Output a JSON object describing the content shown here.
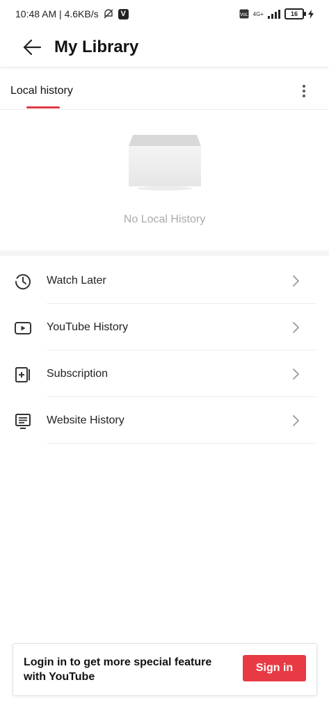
{
  "status_bar": {
    "time_speed": "10:48 AM | 4.6KB/s",
    "network": "4G+",
    "battery": "16"
  },
  "header": {
    "title": "My Library"
  },
  "tabs": {
    "active_label": "Local history"
  },
  "empty_state": {
    "message": "No Local History"
  },
  "menu": {
    "items": [
      {
        "label": "Watch Later",
        "icon": "clock-icon"
      },
      {
        "label": "YouTube History",
        "icon": "play-icon"
      },
      {
        "label": "Subscription",
        "icon": "subscription-icon"
      },
      {
        "label": "Website History",
        "icon": "monitor-icon"
      }
    ]
  },
  "login_banner": {
    "message": "Login in to get more special feature with YouTube",
    "button_label": "Sign in"
  },
  "colors": {
    "accent": "#e83a44",
    "divider": "#eeeeee",
    "muted_text": "#aaaaaa"
  }
}
